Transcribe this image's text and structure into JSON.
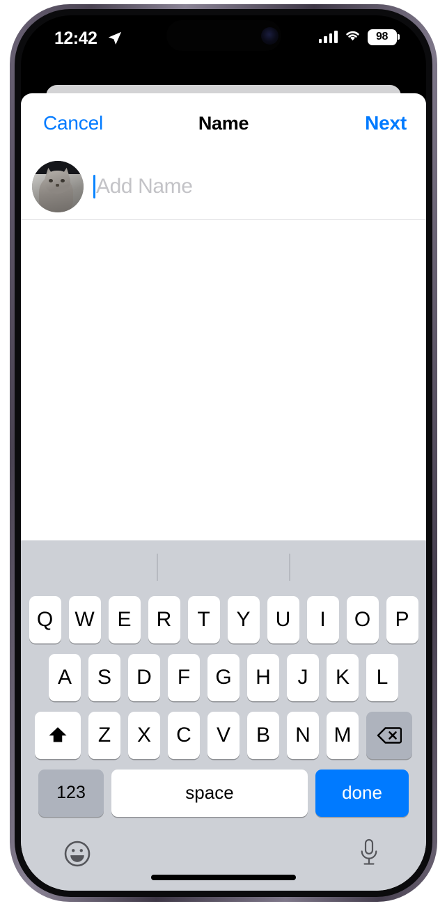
{
  "status_bar": {
    "time": "12:42",
    "location_icon": "location-arrow-icon",
    "cellular_icon": "cellular-bars-icon",
    "wifi_icon": "wifi-icon",
    "battery_level": "98"
  },
  "nav_bar": {
    "cancel_label": "Cancel",
    "title": "Name",
    "next_label": "Next"
  },
  "name_field": {
    "avatar_name": "cat-avatar",
    "placeholder": "Add Name",
    "value": ""
  },
  "keyboard": {
    "predictive_suggestions": [
      "",
      "",
      ""
    ],
    "row_1": [
      "Q",
      "W",
      "E",
      "R",
      "T",
      "Y",
      "U",
      "I",
      "O",
      "P"
    ],
    "row_2": [
      "A",
      "S",
      "D",
      "F",
      "G",
      "H",
      "J",
      "K",
      "L"
    ],
    "row_3": [
      "Z",
      "X",
      "C",
      "V",
      "B",
      "N",
      "M"
    ],
    "shift_label": "shift-arrow-icon",
    "delete_label": "delete-left-icon",
    "numbers_label": "123",
    "space_label": "space",
    "return_label": "done",
    "emoji_label": "emoji-smiley-icon",
    "dictation_label": "microphone-icon"
  },
  "colors": {
    "accent_blue": "#007aff",
    "keyboard_bg": "#cdd0d6",
    "key_white": "#ffffff",
    "key_gray": "#aeb3bd",
    "placeholder_gray": "#c3c3c7"
  }
}
